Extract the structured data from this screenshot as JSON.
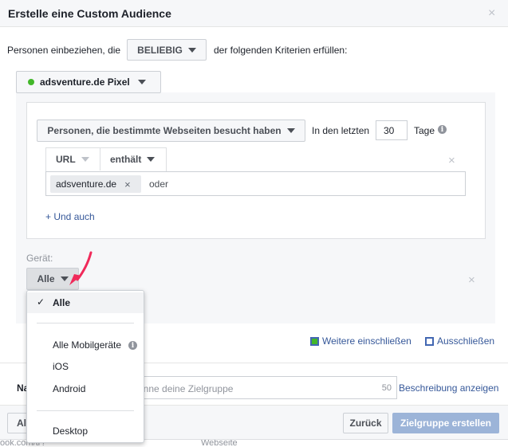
{
  "dialog": {
    "title": "Erstelle eine Custom Audience",
    "close_icon": "×"
  },
  "criteria": {
    "prefix": "Personen einbeziehen, die",
    "match_select": "BELIEBIG",
    "suffix": "der folgenden Kriterien erfüllen:"
  },
  "source": {
    "pixel_label": "adsventure.de Pixel",
    "status_color": "#42b72a"
  },
  "rule": {
    "event_select": "Personen, die bestimmte Webseiten besucht haben",
    "in_last_label": "In den letzten",
    "days_value": "30",
    "days_unit": "Tage",
    "url_select": "URL",
    "operator_select": "enthält",
    "token": "adsventure.de",
    "token_remove": "×",
    "or_placeholder": "oder",
    "and_link": "+ Und auch",
    "remove_icon": "×"
  },
  "device": {
    "label": "Gerät:",
    "select_value": "Alle",
    "remove_icon": "×",
    "dropdown": {
      "options": [
        "Alle",
        "Alle Mobilgeräte",
        "iOS",
        "Android",
        "Desktop"
      ],
      "selected": "Alle",
      "check": "✓"
    }
  },
  "actions": {
    "include_more": "Weitere einschließen",
    "exclude": "Ausschließen"
  },
  "name_row": {
    "label_fragment": "Na",
    "placeholder": "enne deine Zielgruppe",
    "char_count": "50",
    "desc_link": "Beschreibung anzeigen"
  },
  "footer": {
    "left_fragment": "Al",
    "back_button": "Zurück",
    "create_button": "Zielgruppe erstellen",
    "bg_text_1": "ook.com/tr?",
    "bg_text_2": "Webseite"
  },
  "colors": {
    "accent": "#4267b2",
    "disabled_primary": "#9cb4d8",
    "arrow": "#f02a5a"
  }
}
